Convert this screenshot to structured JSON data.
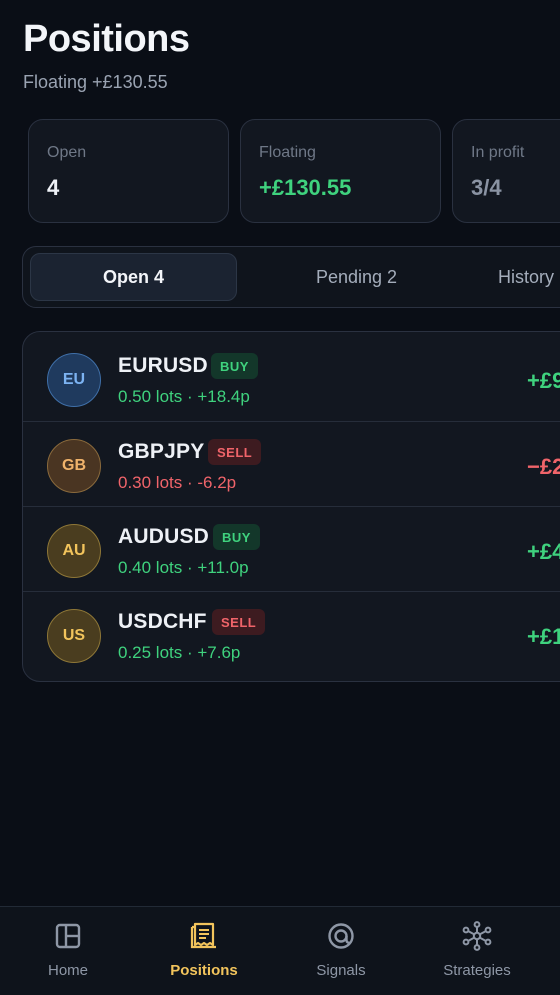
{
  "header": {
    "title": "Positions",
    "subtitle": "Floating +£130.55"
  },
  "stats": [
    {
      "label": "Open",
      "value": "4"
    },
    {
      "label": "Floating",
      "value": "+£130.55"
    },
    {
      "label": "In profit",
      "value": "3/4"
    }
  ],
  "tabs": [
    {
      "label": "Open 4",
      "active": true
    },
    {
      "label": "Pending 2",
      "active": false
    },
    {
      "label": "History",
      "active": false
    }
  ],
  "positions": [
    {
      "avatar": "EU",
      "symbol": "EURUSD",
      "side": "BUY",
      "meta": "0.50 lots · +18.4p",
      "pnl": "+£9"
    },
    {
      "avatar": "GB",
      "symbol": "GBPJPY",
      "side": "SELL",
      "meta": "0.30 lots · -6.2p",
      "pnl": "−£2"
    },
    {
      "avatar": "AU",
      "symbol": "AUDUSD",
      "side": "BUY",
      "meta": "0.40 lots · +11.0p",
      "pnl": "+£4"
    },
    {
      "avatar": "US",
      "symbol": "USDCHF",
      "side": "SELL",
      "meta": "0.25 lots · +7.6p",
      "pnl": "+£1"
    }
  ],
  "nav": [
    {
      "label": "Home",
      "icon": "layout-icon",
      "active": false
    },
    {
      "label": "Positions",
      "icon": "receipt-icon",
      "active": true
    },
    {
      "label": "Signals",
      "icon": "at-signal-icon",
      "active": false
    },
    {
      "label": "Strategies",
      "icon": "network-icon",
      "active": false
    }
  ],
  "colors": {
    "background": "#0a0e16",
    "profit": "#3fd27e",
    "loss": "#f0646a",
    "accent": "#f2c45c"
  }
}
